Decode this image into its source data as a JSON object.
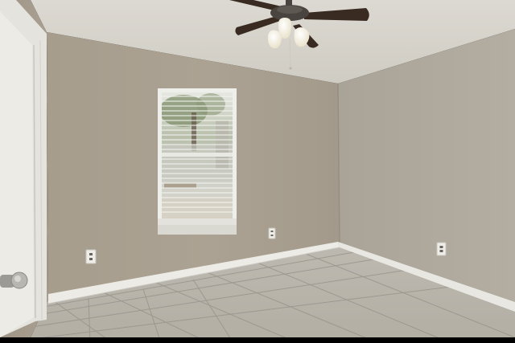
{
  "scene": {
    "kind": "empty-room-interior",
    "colors": {
      "ceiling": "#d6d3cb",
      "wall_left": "#aca394",
      "wall_back": "#a69c8d",
      "wall_right": "#aea89c",
      "floor": "#b9b5ab",
      "grout": "#8f8b82",
      "baseboard": "#ecebe6",
      "door": "#ecebe6",
      "window_frame": "#eeeeea",
      "fan_blade": "#3a2b22",
      "fan_motor": "#4a4440",
      "lamp_glass": "#f5f1e4"
    },
    "objects": [
      {
        "name": "ceiling",
        "icon": "textured-ceiling"
      },
      {
        "name": "ceiling-fan",
        "icon": "ceiling-fan-icon",
        "blades": 4,
        "lamps": 3
      },
      {
        "name": "window",
        "icon": "window-blinds-icon"
      },
      {
        "name": "door",
        "icon": "door-icon",
        "hardware": "lever-handle"
      },
      {
        "name": "outlets",
        "icon": "power-outlet-icon",
        "count": 3
      },
      {
        "name": "floor",
        "icon": "tile-floor"
      },
      {
        "name": "baseboards",
        "icon": "baseboard-trim"
      }
    ]
  }
}
